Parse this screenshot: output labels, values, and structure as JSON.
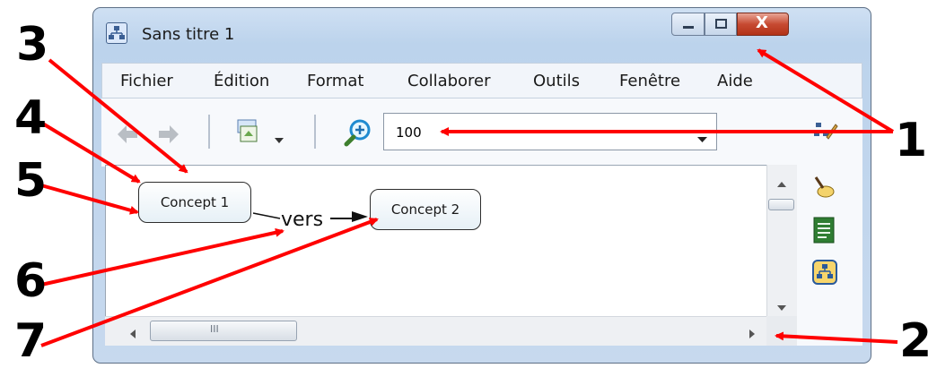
{
  "window": {
    "title": "Sans titre 1",
    "close_symbol": "X"
  },
  "menubar": {
    "items": [
      "Fichier",
      "Édition",
      "Format",
      "Collaborer",
      "Outils",
      "Fenêtre",
      "Aide"
    ]
  },
  "toolbar": {
    "icons": [
      "back-arrow-icon",
      "forward-arrow-icon",
      "nested-node-icon",
      "zoom-icon"
    ],
    "zoom_value": "100"
  },
  "map": {
    "concepts": [
      "Concept 1",
      "Concept 2"
    ],
    "link_label": "vers"
  },
  "scrollbar": {
    "grip": "III"
  },
  "side_tools": [
    "styles-icon",
    "brush-icon",
    "outline-icon",
    "map-icon"
  ],
  "annotations": [
    "1",
    "2",
    "3",
    "4",
    "5",
    "6",
    "7"
  ],
  "colors": {
    "arrow": "#ff0000",
    "close_button": "#c74a32",
    "frame": "#bcd3ec"
  }
}
